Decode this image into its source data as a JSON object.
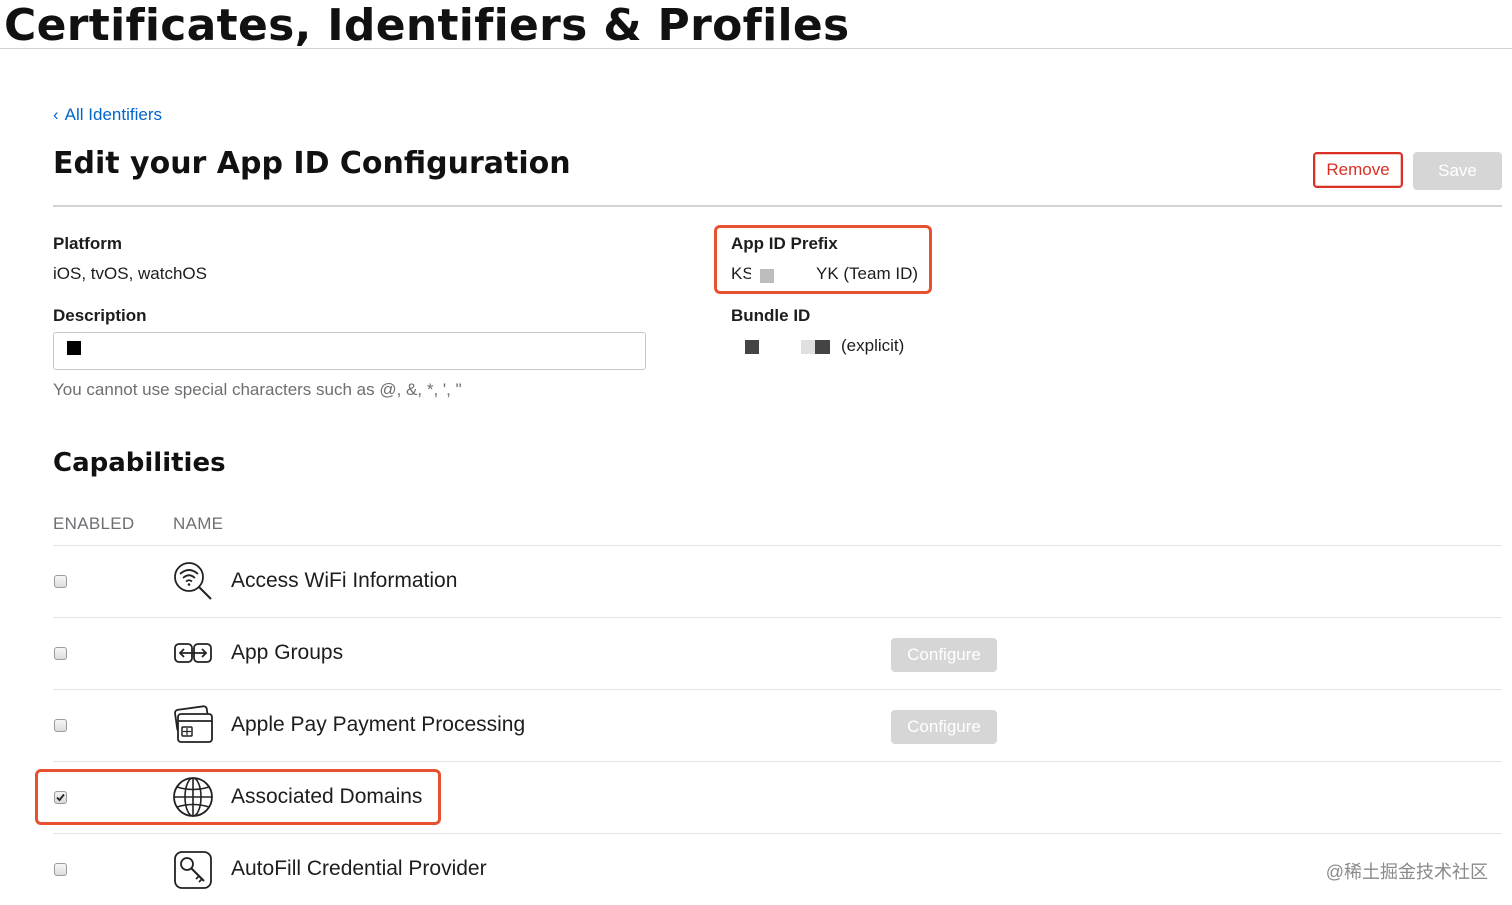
{
  "header": {
    "site_title": "Certificates, Identifiers & Profiles"
  },
  "nav": {
    "back_label": "All Identifiers"
  },
  "page": {
    "title": "Edit your App ID Configuration",
    "remove_label": "Remove",
    "save_label": "Save"
  },
  "details": {
    "platform_label": "Platform",
    "platform_value": "iOS, tvOS, watchOS",
    "app_id_prefix_label": "App ID Prefix",
    "app_id_prefix_start": "KS",
    "app_id_prefix_end": "YK (Team ID)",
    "description_label": "Description",
    "description_hint": "You cannot use special characters such as @, &, *, ', \"",
    "bundle_id_label": "Bundle ID",
    "bundle_id_suffix": "(explicit)"
  },
  "capabilities": {
    "title": "Capabilities",
    "col_enabled": "ENABLED",
    "col_name": "NAME",
    "items": [
      {
        "name": "Access WiFi Information",
        "icon": "wifi-search-icon",
        "enabled": false,
        "configure": ""
      },
      {
        "name": "App Groups",
        "icon": "app-groups-icon",
        "enabled": false,
        "configure": "Configure"
      },
      {
        "name": "Apple Pay Payment Processing",
        "icon": "wallet-icon",
        "enabled": false,
        "configure": "Configure"
      },
      {
        "name": "Associated Domains",
        "icon": "globe-icon",
        "enabled": true,
        "configure": ""
      },
      {
        "name": "AutoFill Credential Provider",
        "icon": "key-icon",
        "enabled": false,
        "configure": ""
      }
    ]
  },
  "colors": {
    "accent": "#0066cc",
    "danger": "#d93025",
    "highlight": "#e8512f",
    "disabled": "#d6d6d6"
  },
  "watermark": "@稀土掘金技术社区"
}
